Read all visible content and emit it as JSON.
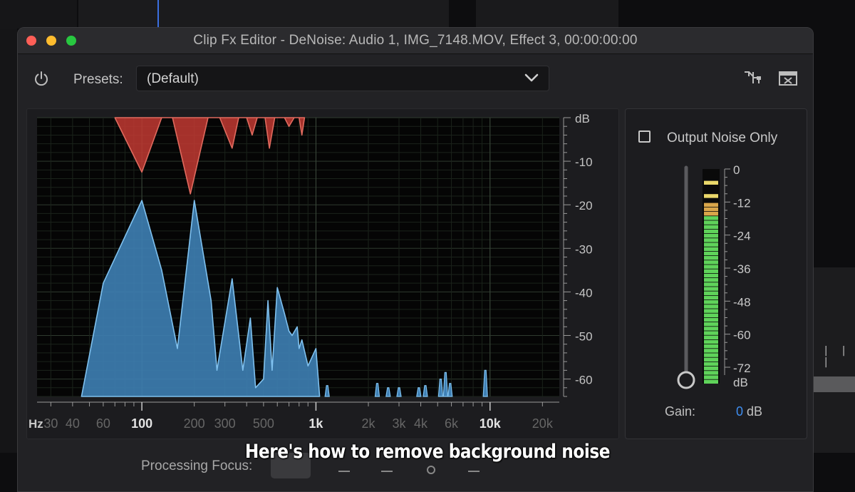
{
  "window": {
    "title": "Clip Fx Editor - DeNoise: Audio 1, IMG_7148.MOV, Effect 3, 00:00:00:00"
  },
  "toolbar": {
    "presets_label": "Presets:",
    "presets_value": "(Default)"
  },
  "output_noise_only": {
    "label": "Output Noise Only",
    "checked": false
  },
  "meter": {
    "scale_labels": [
      "0",
      "-12",
      "-24",
      "-36",
      "-48",
      "-60",
      "-72",
      "dB"
    ],
    "gain_label": "Gain:",
    "gain_value": "0",
    "gain_unit": "dB"
  },
  "processing_focus": {
    "label": "Processing Focus:"
  },
  "caption": "Here's how to remove background noise",
  "colors": {
    "signal_fill": "#3e7fb4",
    "signal_stroke": "#7fc1ef",
    "noise_fill": "#c23a32",
    "meter_green": "#5fd35a",
    "accent_blue": "#3f8ef0"
  },
  "chart_data": {
    "type": "area",
    "xscale": "log",
    "xlim": [
      25,
      25000
    ],
    "ylim": [
      -64,
      0
    ],
    "x_axis_unit": "Hz",
    "y_axis_unit": "dB",
    "x_ticks": [
      {
        "v": 30,
        "label": "30",
        "major": false
      },
      {
        "v": 40,
        "label": "40",
        "major": false
      },
      {
        "v": 60,
        "label": "60",
        "major": false
      },
      {
        "v": 100,
        "label": "100",
        "major": true
      },
      {
        "v": 200,
        "label": "200",
        "major": false
      },
      {
        "v": 300,
        "label": "300",
        "major": false
      },
      {
        "v": 500,
        "label": "500",
        "major": false
      },
      {
        "v": 1000,
        "label": "1k",
        "major": true
      },
      {
        "v": 2000,
        "label": "2k",
        "major": false
      },
      {
        "v": 3000,
        "label": "3k",
        "major": false
      },
      {
        "v": 4000,
        "label": "4k",
        "major": false
      },
      {
        "v": 6000,
        "label": "6k",
        "major": false
      },
      {
        "v": 10000,
        "label": "10k",
        "major": true
      },
      {
        "v": 20000,
        "label": "20k",
        "major": false
      }
    ],
    "y_ticks": [
      {
        "v": -10,
        "label": "-10"
      },
      {
        "v": -20,
        "label": "-20"
      },
      {
        "v": -30,
        "label": "-30"
      },
      {
        "v": -40,
        "label": "-40"
      },
      {
        "v": -50,
        "label": "-50"
      },
      {
        "v": -60,
        "label": "-60"
      }
    ],
    "series": [
      {
        "points": [
          [
            45,
            -64
          ],
          [
            60,
            -38
          ],
          [
            100,
            -19
          ],
          [
            130,
            -35
          ],
          [
            160,
            -53
          ],
          [
            200,
            -19
          ],
          [
            250,
            -42
          ],
          [
            270,
            -58
          ],
          [
            330,
            -37
          ],
          [
            380,
            -58
          ],
          [
            420,
            -46
          ],
          [
            450,
            -62
          ],
          [
            500,
            -60
          ],
          [
            530,
            -42
          ],
          [
            560,
            -58
          ],
          [
            600,
            -39
          ],
          [
            660,
            -45
          ],
          [
            700,
            -49
          ],
          [
            730,
            -50
          ],
          [
            780,
            -48
          ],
          [
            800,
            -53
          ],
          [
            830,
            -51
          ],
          [
            900,
            -57
          ],
          [
            1000,
            -53
          ],
          [
            1050,
            -64
          ]
        ]
      },
      {
        "points": [
          [
            70,
            0
          ],
          [
            100,
            -12.5
          ],
          [
            130,
            0
          ],
          [
            150,
            0
          ],
          [
            190,
            -17.5
          ],
          [
            240,
            0
          ],
          [
            280,
            0
          ],
          [
            330,
            -7
          ],
          [
            360,
            0
          ],
          [
            400,
            0
          ],
          [
            430,
            -4
          ],
          [
            460,
            0
          ],
          [
            510,
            0
          ],
          [
            540,
            -7
          ],
          [
            580,
            0
          ],
          [
            660,
            0
          ],
          [
            700,
            -2
          ],
          [
            750,
            0
          ],
          [
            800,
            0
          ],
          [
            830,
            -4
          ],
          [
            860,
            0
          ]
        ]
      }
    ],
    "peaks": [
      {
        "x": 1160,
        "y": -61.5
      },
      {
        "x": 2250,
        "y": -61
      },
      {
        "x": 2600,
        "y": -62
      },
      {
        "x": 3000,
        "y": -62
      },
      {
        "x": 3900,
        "y": -62
      },
      {
        "x": 4250,
        "y": -61.5
      },
      {
        "x": 5200,
        "y": -60
      },
      {
        "x": 5550,
        "y": -58.5
      },
      {
        "x": 5900,
        "y": -61
      },
      {
        "x": 9400,
        "y": -58
      }
    ]
  }
}
